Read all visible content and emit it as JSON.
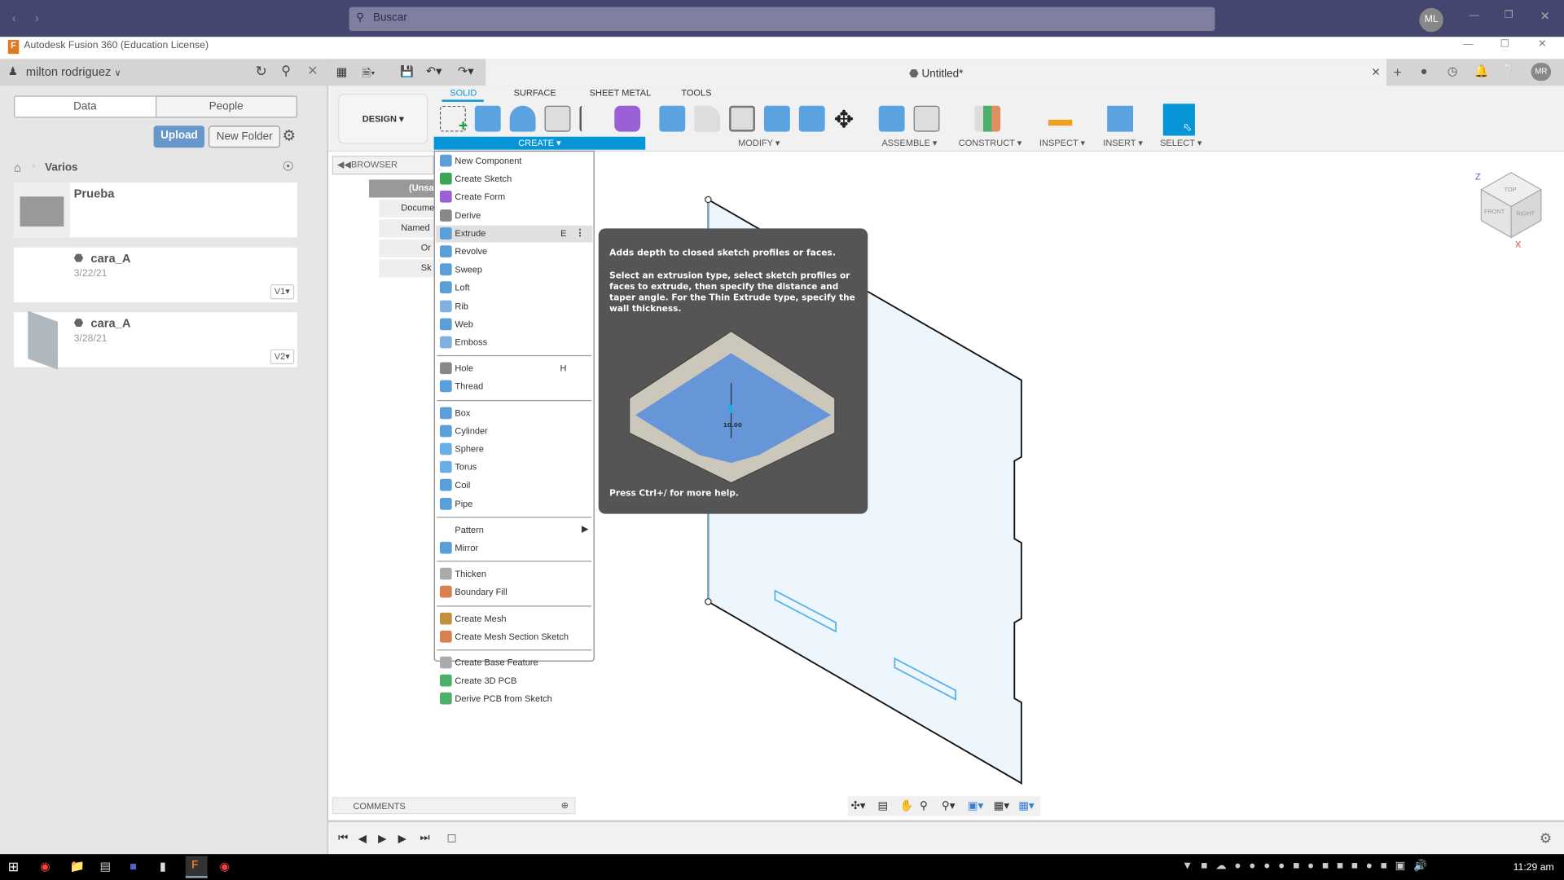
{
  "os": {
    "search_placeholder": "Buscar",
    "avatar": "ML",
    "clock": "11:29 am"
  },
  "window": {
    "title": "Autodesk Fusion 360 (Education License)"
  },
  "data_panel": {
    "user": "milton rodriguez",
    "tabs": [
      "Data",
      "People"
    ],
    "upload": "Upload",
    "new_folder": "New Folder",
    "breadcrumb": "Varios",
    "items": [
      {
        "name": "Prueba",
        "type": "folder"
      },
      {
        "name": "cara_A",
        "date": "3/22/21",
        "version": "V1"
      },
      {
        "name": "cara_A",
        "date": "3/28/21",
        "version": "V2"
      }
    ]
  },
  "document": {
    "title": "Untitled*",
    "user_initials": "MR"
  },
  "ribbon": {
    "workspace": "DESIGN",
    "tabs": [
      "SOLID",
      "SURFACE",
      "SHEET METAL",
      "TOOLS"
    ],
    "active_tab": "SOLID",
    "groups": [
      "CREATE",
      "MODIFY",
      "ASSEMBLE",
      "CONSTRUCT",
      "INSPECT",
      "INSERT",
      "SELECT"
    ],
    "accent": "#0696d7"
  },
  "browser": {
    "title": "BROWSER",
    "rows": [
      "(Unsa",
      "Docume",
      "Named",
      "Or",
      "Sk"
    ]
  },
  "create_menu": {
    "groups": [
      [
        {
          "label": "New Component",
          "icon": "new-component-icon",
          "color": "#5a9fd8"
        },
        {
          "label": "Create Sketch",
          "icon": "sketch-icon",
          "color": "#3aa655"
        },
        {
          "label": "Create Form",
          "icon": "form-icon",
          "color": "#9b5fd6"
        },
        {
          "label": "Derive",
          "icon": "derive-icon",
          "color": "#888"
        },
        {
          "label": "Extrude",
          "icon": "extrude-icon",
          "color": "#5a9fd8",
          "shortcut": "E",
          "highlighted": true
        },
        {
          "label": "Revolve",
          "icon": "revolve-icon",
          "color": "#5a9fd8"
        },
        {
          "label": "Sweep",
          "icon": "sweep-icon",
          "color": "#5a9fd8"
        },
        {
          "label": "Loft",
          "icon": "loft-icon",
          "color": "#5a9fd8"
        },
        {
          "label": "Rib",
          "icon": "rib-icon",
          "color": "#7fb0e0"
        },
        {
          "label": "Web",
          "icon": "web-icon",
          "color": "#5a9fd8"
        },
        {
          "label": "Emboss",
          "icon": "emboss-icon",
          "color": "#7fb0e0"
        }
      ],
      [
        {
          "label": "Hole",
          "icon": "hole-icon",
          "color": "#888",
          "shortcut": "H"
        },
        {
          "label": "Thread",
          "icon": "thread-icon",
          "color": "#5a9fd8"
        }
      ],
      [
        {
          "label": "Box",
          "icon": "box-icon",
          "color": "#5a9fd8"
        },
        {
          "label": "Cylinder",
          "icon": "cylinder-icon",
          "color": "#5a9fd8"
        },
        {
          "label": "Sphere",
          "icon": "sphere-icon",
          "color": "#6aaee8"
        },
        {
          "label": "Torus",
          "icon": "torus-icon",
          "color": "#6aaee8"
        },
        {
          "label": "Coil",
          "icon": "coil-icon",
          "color": "#5a9fd8"
        },
        {
          "label": "Pipe",
          "icon": "pipe-icon",
          "color": "#5a9fd8"
        }
      ],
      [
        {
          "label": "Pattern",
          "icon": "",
          "submenu": true
        },
        {
          "label": "Mirror",
          "icon": "mirror-icon",
          "color": "#5a9fd8"
        }
      ],
      [
        {
          "label": "Thicken",
          "icon": "thicken-icon",
          "color": "#aaa"
        },
        {
          "label": "Boundary Fill",
          "icon": "boundary-fill-icon",
          "color": "#d88050"
        }
      ],
      [
        {
          "label": "Create Mesh",
          "icon": "mesh-icon",
          "color": "#c09040"
        },
        {
          "label": "Create Mesh Section Sketch",
          "icon": "mesh-section-icon",
          "color": "#d88050"
        }
      ],
      [
        {
          "label": "Create Base Feature",
          "icon": "base-feature-icon",
          "color": "#aaa"
        },
        {
          "label": "Create 3D PCB",
          "icon": "pcb-icon",
          "color": "#4caf6a"
        },
        {
          "label": "Derive PCB from Sketch",
          "icon": "derive-pcb-icon",
          "color": "#4caf6a"
        }
      ]
    ]
  },
  "tooltip": {
    "headline": "Adds depth to closed sketch profiles or faces.",
    "body": "Select an extrusion type, select sketch profiles or faces to extrude, then specify the distance and taper angle. For the Thin Extrude type, specify the wall thickness.",
    "dimension": "10.00",
    "footer": "Press Ctrl+/ for more help."
  },
  "viewcube": {
    "top": "TOP",
    "front": "FRONT",
    "right": "RIGHT",
    "axis_z": "Z",
    "axis_x": "X"
  },
  "comments": {
    "label": "COMMENTS"
  }
}
